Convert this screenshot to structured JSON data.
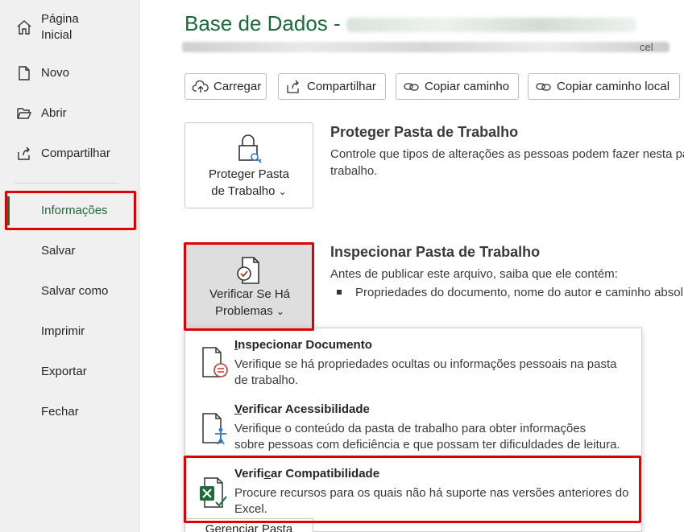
{
  "sidebar": {
    "items": [
      {
        "label": "Página Inicial",
        "line1": "Página",
        "line2": "Inicial",
        "icon": "home-icon"
      },
      {
        "label": "Novo",
        "icon": "new-document-icon"
      },
      {
        "label": "Abrir",
        "icon": "folder-open-icon"
      },
      {
        "label": "Compartilhar",
        "icon": "share-icon"
      },
      {
        "label": "Informações",
        "active": true
      },
      {
        "label": "Salvar"
      },
      {
        "label": "Salvar como"
      },
      {
        "label": "Imprimir"
      },
      {
        "label": "Exportar"
      },
      {
        "label": "Fechar"
      }
    ]
  },
  "header": {
    "title_prefix": "Base de Dados - "
  },
  "path": {
    "visible_end": "cel"
  },
  "toolbar": {
    "upload_label": "Carregar",
    "share_label": "Compartilhar",
    "copy_path_label": "Copiar caminho",
    "copy_local_path_label": "Copiar caminho local"
  },
  "protect": {
    "button_line1": "Proteger Pasta",
    "button_line2": "de Trabalho",
    "chevron": "⌄",
    "heading": "Proteger Pasta de Trabalho",
    "desc_line1": "Controle que tipos de alterações as pessoas podem fazer nesta pa",
    "desc_line2": "trabalho."
  },
  "inspect": {
    "button_line1": "Verificar Se Há",
    "button_line2": "Problemas",
    "chevron": "⌄",
    "heading": "Inspecionar Pasta de Trabalho",
    "desc": "Antes de publicar este arquivo, saiba que ele contém:",
    "bullet": "Propriedades do documento, nome do autor e caminho absol"
  },
  "menu": {
    "items": [
      {
        "title_underlined": "I",
        "title_rest": "nspecionar Documento",
        "desc_line1": "Verifique se há propriedades ocultas ou informações pessoais na pasta",
        "desc_line2": "de trabalho.",
        "icon": "inspect-document-icon"
      },
      {
        "title_underlined": "V",
        "title_rest": "erificar Acessibilidade",
        "desc_line1": "Verifique o conteúdo da pasta de trabalho para obter informações",
        "desc_line2": "sobre pessoas com deficiência e que possam ter dificuldades de leitura.",
        "icon": "accessibility-check-icon"
      },
      {
        "title_before": "Verifi",
        "title_underlined": "c",
        "title_rest": "ar Compatibilidade",
        "desc_line1": "Procure recursos para os quais não há suporte nas versões anteriores do",
        "desc_line2": "Excel.",
        "icon": "excel-compatibility-icon"
      }
    ]
  },
  "manage": {
    "partial_label": "Gerenciar Pasta"
  },
  "colors": {
    "accent": "#1f6b3b",
    "title_green": "#1a6b3a",
    "highlight_red": "#e00000"
  }
}
